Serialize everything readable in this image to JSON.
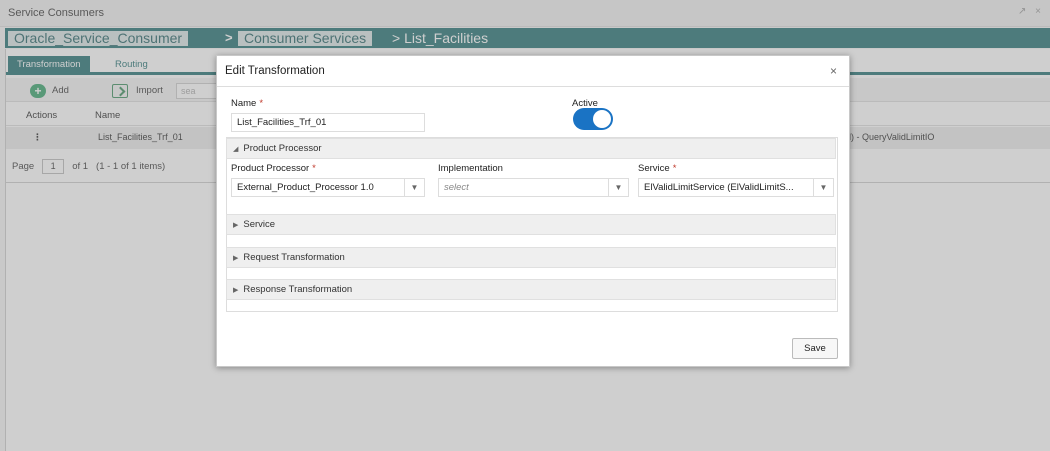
{
  "window": {
    "title": "Service Consumers",
    "controls": "↗ ×"
  },
  "breadcrumb": {
    "items": [
      "Oracle_Service_Consumer",
      "Consumer Services"
    ],
    "separator": ">",
    "current": "> List_Facilities"
  },
  "tabs": [
    "Transformation",
    "Routing"
  ],
  "toolbar": {
    "add_label": "Add",
    "import_label": "Import",
    "search_placeholder": "sea"
  },
  "grid": {
    "columns": [
      "Actions",
      "Name"
    ],
    "rows": [
      {
        "actions": "⋮",
        "name": "List_Facilities_Trf_01",
        "trailing": "l) - QueryValidLimitIO"
      }
    ]
  },
  "pager": {
    "page_label": "Page",
    "page_value": "1",
    "of_label": "of 1",
    "items_label": "(1 - 1 of 1 items)"
  },
  "modal": {
    "title": "Edit Transformation",
    "close_glyph": "×",
    "name_label": "Name",
    "required_mark": "*",
    "name_value": "List_Facilities_Trf_01",
    "active_label": "Active",
    "active_on": true,
    "product_processor_section": "Product Processor",
    "product_processor_label": "Product Processor",
    "product_processor_value": "External_Product_Processor 1.0",
    "implementation_label": "Implementation",
    "implementation_placeholder": "select",
    "service_label": "Service",
    "service_value": "ElValidLimitService (ElValidLimitS...",
    "accordions": [
      "Service",
      "Request Transformation",
      "Response Transformation"
    ],
    "save_label": "Save"
  },
  "colors": {
    "accent": "#1f6f70",
    "toggle": "#1a73c4",
    "add_icon": "#35a36a"
  }
}
